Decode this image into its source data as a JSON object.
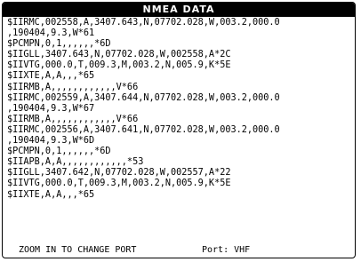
{
  "window": {
    "title": "NMEA DATA"
  },
  "log_lines": [
    "$IIRMC,002558,A,3407.643,N,07702.028,W,003.2,000.0",
    ",190404,9.3,W*61",
    "$PCMPN,0,1,,,,,,*6D",
    "$IIGLL,3407.643,N,07702.028,W,002558,A*2C",
    "$IIVTG,000.0,T,009.3,M,003.2,N,005.9,K*5E",
    "$IIXTE,A,A,,,*65",
    "$IIRMB,A,,,,,,,,,,,,V*66",
    "$IIRMC,002559,A,3407.644,N,07702.028,W,003.2,000.0",
    ",190404,9.3,W*67",
    "$IIRMB,A,,,,,,,,,,,,V*66",
    "$IIRMC,002556,A,3407.641,N,07702.028,W,003.2,000.0",
    ",190404,9.3,W*6D",
    "$PCMPN,0,1,,,,,,*6D",
    "$IIAPB,A,A,,,,,,,,,,,,*53",
    "$IIGLL,3407.642,N,07702.028,W,002557,A*22",
    "$IIVTG,000.0,T,009.3,M,003.2,N,005.9,K*5E",
    "$IIXTE,A,A,,,*65"
  ],
  "status": {
    "hint": "ZOOM IN TO CHANGE PORT",
    "port_label": "Port:",
    "port_value": "VHF"
  }
}
